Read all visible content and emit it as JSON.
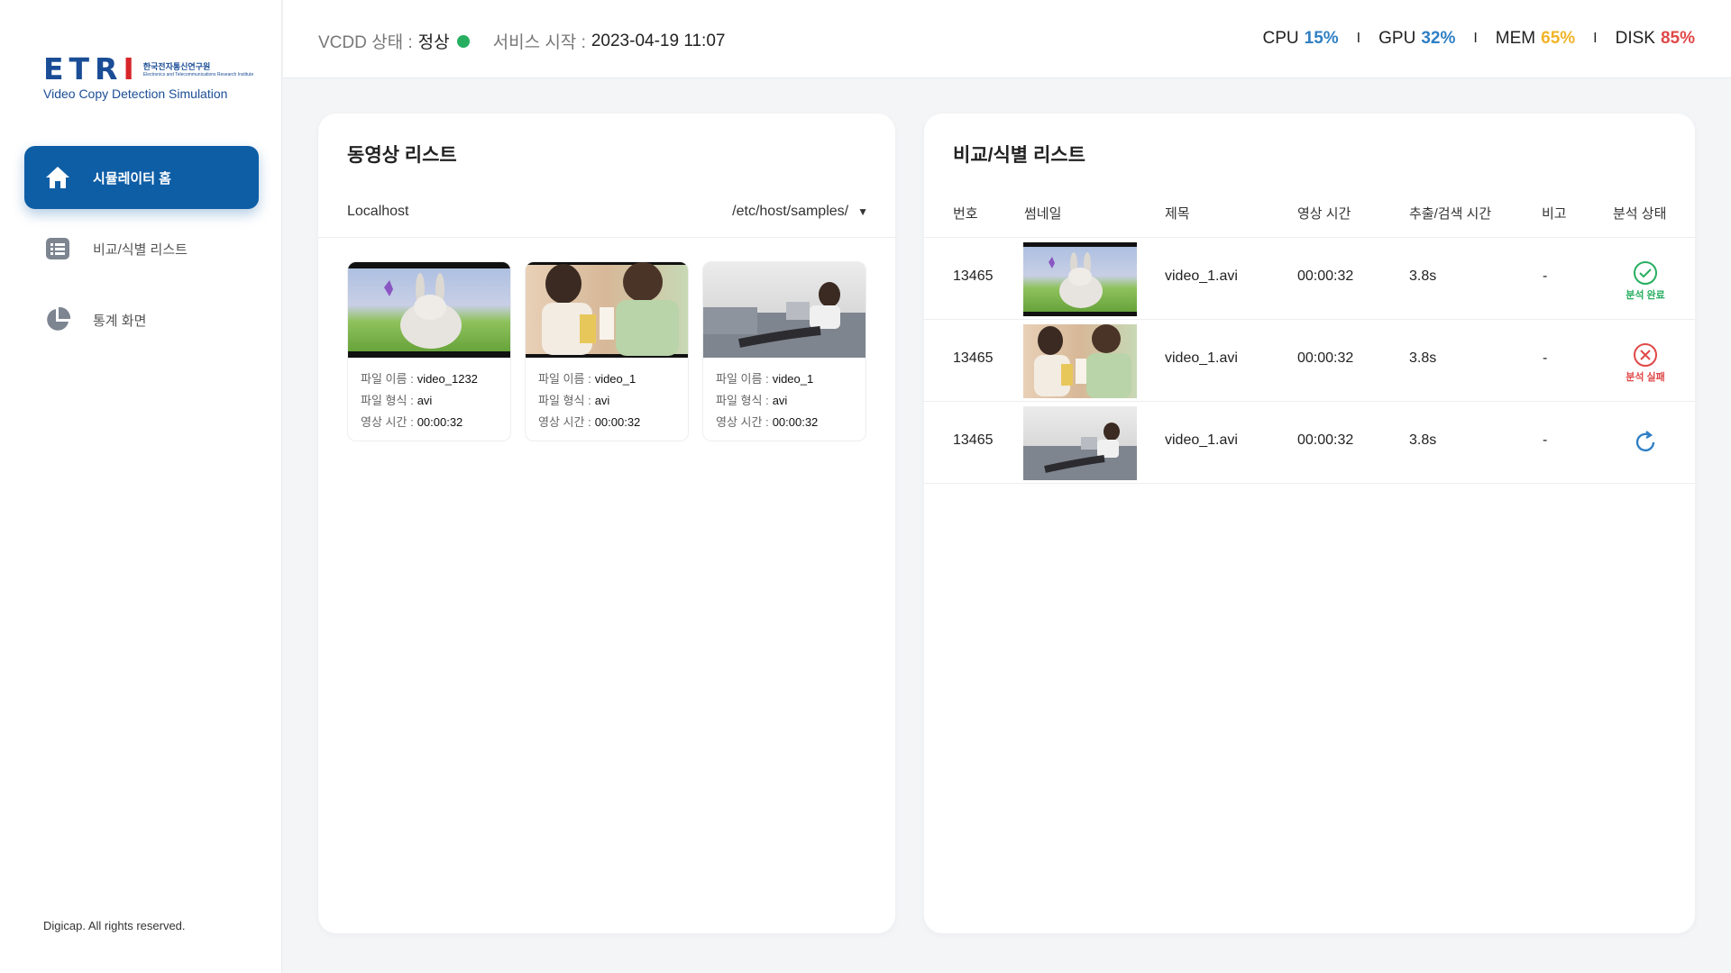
{
  "sidebar": {
    "logo": {
      "etri_prefix": "ETR",
      "etri_suffix": "I",
      "institute_kr": "한국전자통신연구원",
      "institute_en": "Electronics and Telecommunications Research Institute",
      "subtitle": "Video Copy Detection Simulation"
    },
    "nav": [
      {
        "label": "시뮬레이터 홈",
        "icon": "home-icon",
        "active": true
      },
      {
        "label": "비교/식별 리스트",
        "icon": "list-icon",
        "active": false
      },
      {
        "label": "통계 화면",
        "icon": "pie-chart-icon",
        "active": false
      }
    ],
    "copyright": "Digicap. All rights reserved."
  },
  "topbar": {
    "vcdd_label": "VCDD 상태 :",
    "vcdd_value": "정상",
    "service_label": "서비스 시작 :",
    "service_value": "2023-04-19 11:07",
    "metrics": [
      {
        "name": "CPU",
        "value": "15%",
        "color": "#2f7fc4"
      },
      {
        "name": "GPU",
        "value": "32%",
        "color": "#2f7fc4"
      },
      {
        "name": "MEM",
        "value": "65%",
        "color": "#f0b429"
      },
      {
        "name": "DISK",
        "value": "85%",
        "color": "#e04848"
      }
    ],
    "separator": "I",
    "status_color": "#27ae60"
  },
  "video_list": {
    "title": "동영상 리스트",
    "host": "Localhost",
    "path": "/etc/host/samples/",
    "caret": "▼",
    "labels": {
      "name": "파일 이름 :",
      "format": "파일 형식 :",
      "duration": "영상 시간 :"
    },
    "items": [
      {
        "name": "video_1232",
        "format": "avi",
        "duration": "00:00:32",
        "scene": "bunny"
      },
      {
        "name": "video_1",
        "format": "avi",
        "duration": "00:00:32",
        "scene": "women"
      },
      {
        "name": "video_1",
        "format": "avi",
        "duration": "00:00:32",
        "scene": "laptop"
      }
    ]
  },
  "compare_list": {
    "title": "비교/식별 리스트",
    "columns": [
      "번호",
      "썸네일",
      "제목",
      "영상 시간",
      "추출/검색 시간",
      "비고",
      "분석 상태"
    ],
    "rows": [
      {
        "no": "13465",
        "scene": "bunny",
        "title": "video_1.avi",
        "duration": "00:00:32",
        "time": "3.8s",
        "note": "-",
        "state": "done",
        "state_text": "분석 완료",
        "state_color": "#27ae60"
      },
      {
        "no": "13465",
        "scene": "women",
        "title": "video_1.avi",
        "duration": "00:00:32",
        "time": "3.8s",
        "note": "-",
        "state": "fail",
        "state_text": "분석 실패",
        "state_color": "#e04848"
      },
      {
        "no": "13465",
        "scene": "laptop",
        "title": "video_1.avi",
        "duration": "00:00:32",
        "time": "3.8s",
        "note": "-",
        "state": "loading",
        "state_text": "",
        "state_color": "#2f7fc4"
      }
    ]
  }
}
